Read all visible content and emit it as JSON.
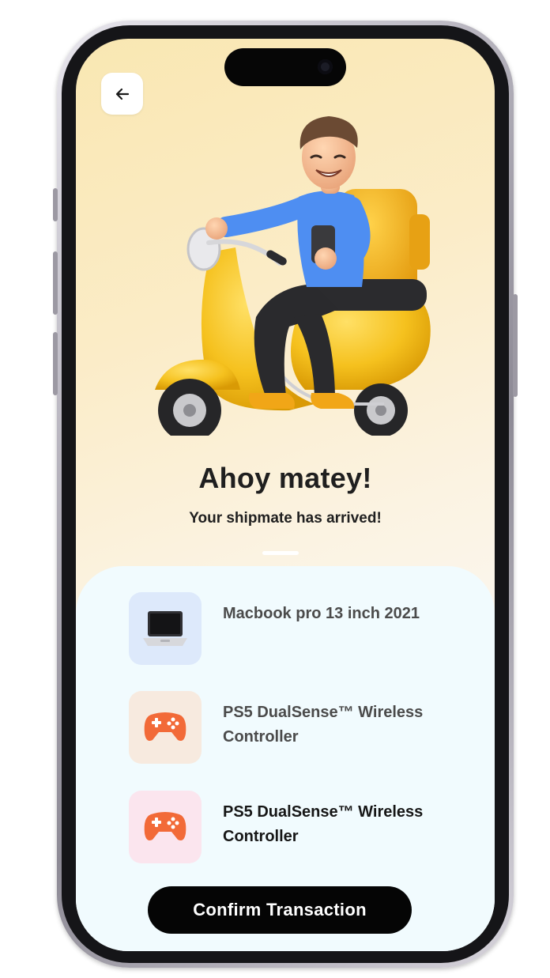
{
  "screen": {
    "title": "Ahoy matey!",
    "subtitle": "Your shipmate has arrived!"
  },
  "header": {
    "back_icon": "arrow-left-icon"
  },
  "items": [
    {
      "label": "Macbook pro 13 inch 2021",
      "icon": "laptop-icon",
      "thumb_color": "#dde9fb",
      "text_color": "#4b4b4b"
    },
    {
      "label": "PS5 DualSense™ Wireless Controller",
      "icon": "gamepad-icon",
      "thumb_color": "#f7eadf",
      "text_color": "#4b4b4b"
    },
    {
      "label": "PS5 DualSense™ Wireless Controller",
      "icon": "gamepad-icon",
      "thumb_color": "#fbe5ee",
      "text_color": "#161616"
    }
  ],
  "actions": {
    "confirm_label": "Confirm Transaction"
  },
  "colors": {
    "accent": "#f5c11e",
    "button": "#050505",
    "sheet": "#f1fbfe"
  }
}
